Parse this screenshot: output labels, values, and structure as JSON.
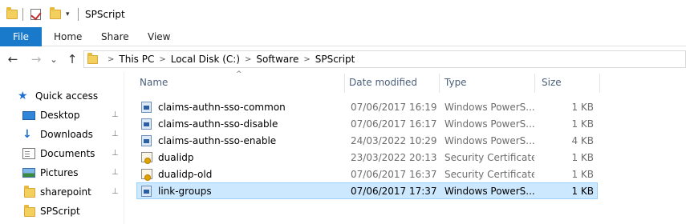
{
  "window": {
    "title": "SPScript"
  },
  "quick_access_toolbar": {
    "icons": [
      "folder-icon",
      "properties-check-icon",
      "new-folder-icon",
      "customize-dropdown-icon"
    ],
    "dropdown_glyph": "▾"
  },
  "ribbon": {
    "file_tab": "File",
    "tabs": [
      "Home",
      "Share",
      "View"
    ]
  },
  "navigation": {
    "back_glyph": "←",
    "forward_glyph": "→",
    "recent_glyph": "⌄",
    "up_glyph": "↑",
    "breadcrumb": [
      "This PC",
      "Local Disk (C:)",
      "Software",
      "SPScript"
    ],
    "separator": ">"
  },
  "nav_pane": {
    "quick_access_label": "Quick access",
    "items": [
      {
        "label": "Desktop",
        "icon": "desktop-icon",
        "pinned": true
      },
      {
        "label": "Downloads",
        "icon": "downloads-icon",
        "pinned": true
      },
      {
        "label": "Documents",
        "icon": "documents-icon",
        "pinned": true
      },
      {
        "label": "Pictures",
        "icon": "pictures-icon",
        "pinned": true
      },
      {
        "label": "sharepoint",
        "icon": "folder-icon",
        "pinned": true
      },
      {
        "label": "SPScript",
        "icon": "folder-icon",
        "pinned": false
      }
    ],
    "pin_glyph": "📌"
  },
  "file_list": {
    "columns": [
      "Name",
      "Date modified",
      "Type",
      "Size"
    ],
    "sort_glyph": "^",
    "rows": [
      {
        "name": "claims-authn-sso-common",
        "date": "07/06/2017 16:19",
        "type": "Windows PowerS...",
        "size": "1 KB",
        "icon": "powershell-script-icon",
        "selected": false
      },
      {
        "name": "claims-authn-sso-disable",
        "date": "07/06/2017 16:17",
        "type": "Windows PowerS...",
        "size": "1 KB",
        "icon": "powershell-script-icon",
        "selected": false
      },
      {
        "name": "claims-authn-sso-enable",
        "date": "24/03/2022 10:29",
        "type": "Windows PowerS...",
        "size": "4 KB",
        "icon": "powershell-script-icon",
        "selected": false
      },
      {
        "name": "dualidp",
        "date": "23/03/2022 20:13",
        "type": "Security Certificate",
        "size": "1 KB",
        "icon": "certificate-icon",
        "selected": false
      },
      {
        "name": "dualidp-old",
        "date": "07/06/2017 16:37",
        "type": "Security Certificate",
        "size": "1 KB",
        "icon": "certificate-icon",
        "selected": false
      },
      {
        "name": "link-groups",
        "date": "07/06/2017 17:37",
        "type": "Windows PowerS...",
        "size": "1 KB",
        "icon": "powershell-script-icon",
        "selected": true
      }
    ]
  },
  "colors": {
    "file_tab_bg": "#1979ca",
    "selection_bg": "#cce8ff",
    "selection_border": "#99d1ff",
    "header_text": "#4c607a",
    "meta_text": "#6d6d6d"
  }
}
